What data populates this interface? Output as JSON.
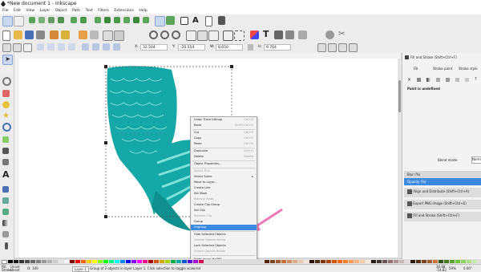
{
  "window": {
    "title": "*New document 1 - Inkscape"
  },
  "menu": [
    "File",
    "Edit",
    "View",
    "Layer",
    "Object",
    "Path",
    "Text",
    "Filters",
    "Extensions",
    "Help"
  ],
  "tool_controls": {
    "x": "32.504",
    "y": "-20.554",
    "w": "8.650",
    "h": "9.764",
    "x_label": "X:",
    "y_label": "Y:",
    "w_label": "W:",
    "h_label": "H:"
  },
  "dock": {
    "fill_stroke_title": "Fill and Stroke (Shift+Ctrl+F)",
    "tabs": [
      "Fill",
      "Stroke paint",
      "Stroke style"
    ],
    "paint_status": "Paint is undefined",
    "blend_label": "Blend mode:",
    "blend_value": "Norm",
    "blur_label": "Blur (%)",
    "opacity_label": "Opacity (%)",
    "panels": [
      "Align and Distribute (Shift+Ctrl+A)",
      "Export PNG Image (Shift+Ctrl+E)",
      "Fill and Stroke (Shift+Ctrl+F)"
    ]
  },
  "context_menu": {
    "items": [
      {
        "label": "Undo: Trace bitmap",
        "shortcut": "Ctrl+Z",
        "disabled": false
      },
      {
        "label": "Redo",
        "shortcut": "Shift+Ctrl+Z",
        "disabled": false
      },
      {
        "label": "Cut",
        "shortcut": "Ctrl+X",
        "disabled": false
      },
      {
        "label": "Copy",
        "shortcut": "Ctrl+C",
        "disabled": false
      },
      {
        "label": "Paste",
        "shortcut": "Ctrl+V",
        "disabled": false
      },
      {
        "label": "Duplicate",
        "shortcut": "Ctrl+D",
        "disabled": false
      },
      {
        "label": "Delete",
        "shortcut": "Delete",
        "disabled": false
      },
      {
        "label": "Object Properties...",
        "shortcut": "",
        "disabled": false
      },
      {
        "label": "Select This",
        "shortcut": "",
        "disabled": true
      },
      {
        "label": "Select Same",
        "shortcut": "▸",
        "disabled": false
      },
      {
        "label": "Move to Layer...",
        "shortcut": "",
        "disabled": false
      },
      {
        "label": "Create Link",
        "shortcut": "",
        "disabled": false
      },
      {
        "label": "Set Mask",
        "shortcut": "",
        "disabled": false
      },
      {
        "label": "Release Mask",
        "shortcut": "",
        "disabled": true
      },
      {
        "label": "Create Clip Group",
        "shortcut": "",
        "disabled": false
      },
      {
        "label": "Set Clip",
        "shortcut": "",
        "disabled": false
      },
      {
        "label": "Release Clip",
        "shortcut": "",
        "disabled": true
      },
      {
        "label": "Group",
        "shortcut": "",
        "disabled": false
      },
      {
        "label": "Ungroup",
        "shortcut": "",
        "disabled": false,
        "highlighted": true
      },
      {
        "label": "Hide Selected Objects",
        "shortcut": "",
        "disabled": false
      },
      {
        "label": "Unhide Objects Below",
        "shortcut": "",
        "disabled": true
      },
      {
        "label": "Lock Selected Objects",
        "shortcut": "",
        "disabled": false
      },
      {
        "label": "Unlock Objects Below",
        "shortcut": "",
        "disabled": true
      },
      {
        "label": "Enter group #g365",
        "shortcut": "",
        "disabled": false
      }
    ]
  },
  "status": {
    "fill_label": "Fill:",
    "fill_value": "Unset",
    "stroke_label": "Stroke:",
    "stroke_value": "Unset",
    "opacity_label": "O:",
    "opacity_value": "100",
    "layer": "Layer 1",
    "message": "Group of 2 objects in layer Layer 1. Click selection to toggle scale/rot",
    "x": "30.68",
    "y": "-14.82",
    "zoom": "59%",
    "rotation": "0.00°"
  },
  "colors": {
    "accent": "#3c8adf",
    "mermaid_teal": "#16a8a6",
    "mermaid_light": "#7fe0dc",
    "pointer_pink": "#f07ab8"
  }
}
